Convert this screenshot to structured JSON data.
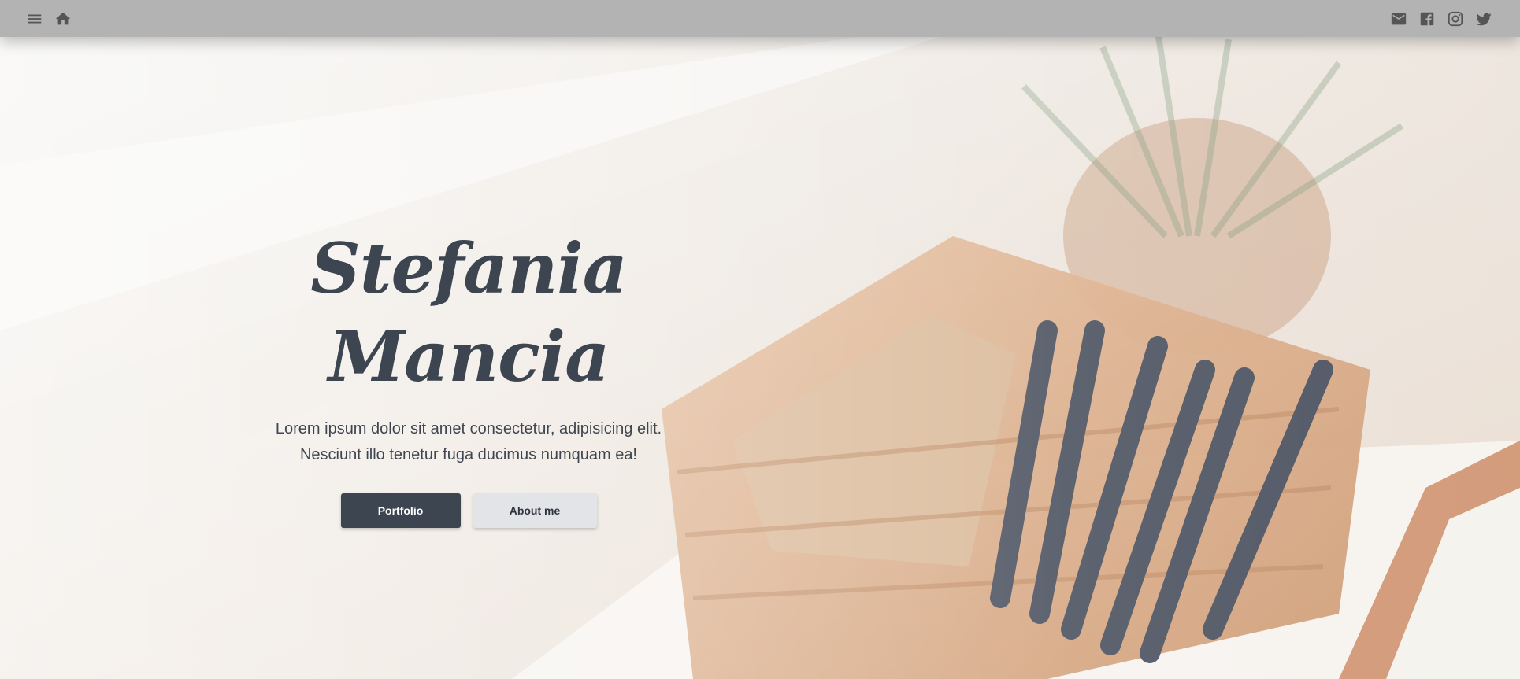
{
  "header": {
    "icons": {
      "menu": "menu-icon",
      "home": "home-icon",
      "mail": "mail-icon",
      "facebook": "facebook-icon",
      "instagram": "instagram-icon",
      "twitter": "twitter-icon"
    }
  },
  "hero": {
    "name_line1": "Stefania",
    "name_line2": "Mancia",
    "text_line1": "Lorem ipsum dolor sit amet consectetur, adipisicing elit.",
    "text_line2": "Nesciunt illo tenetur fuga ducimus numquam ea!",
    "primary_button": "Portfolio",
    "secondary_button": "About me"
  },
  "colors": {
    "topbar": "#b3b3b3",
    "accent": "#3c4550",
    "secondary_button": "#e3e4e8"
  }
}
